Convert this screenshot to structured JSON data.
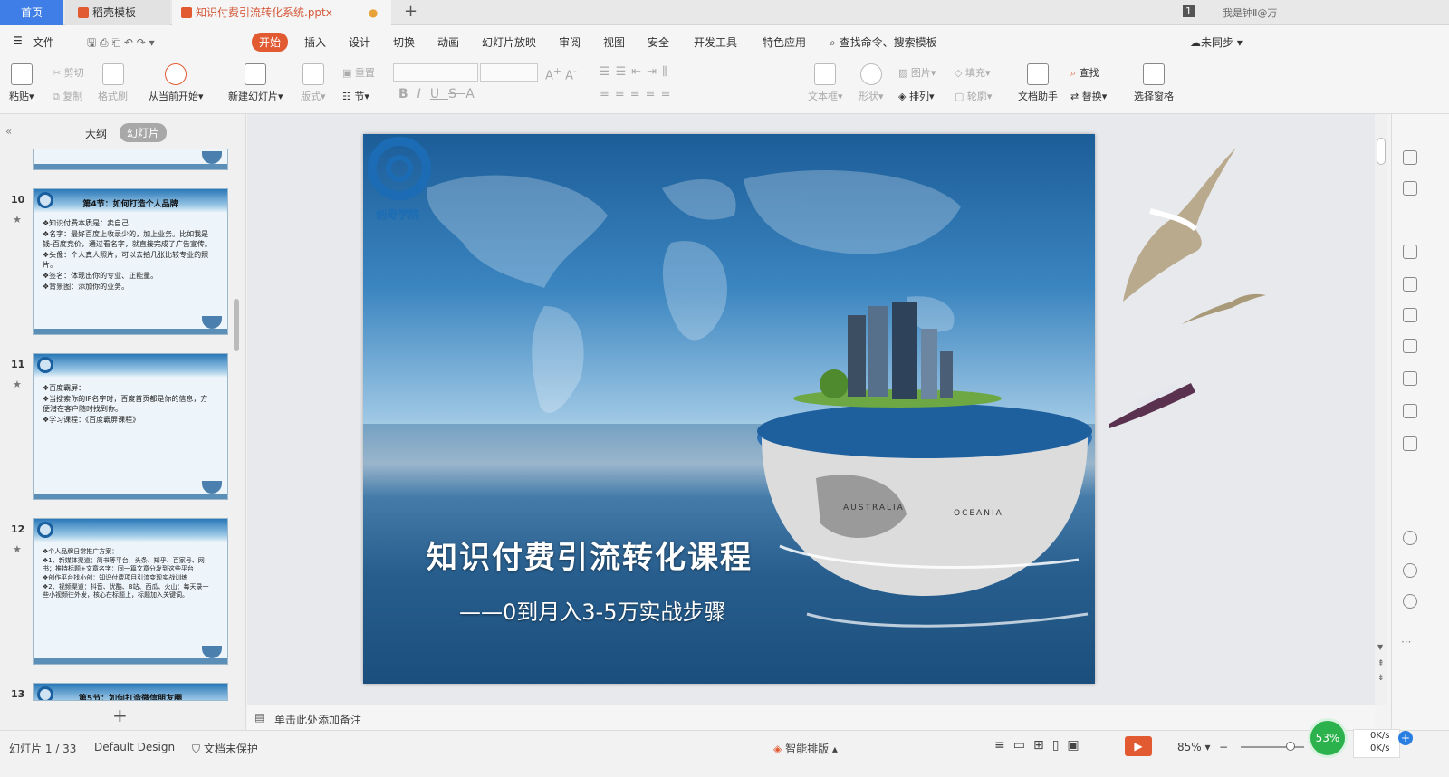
{
  "tabs": {
    "home": "首页",
    "template": "稻壳模板",
    "document": "知识付费引流转化系统.pptx",
    "badge": "1",
    "user": "我是钟Ⅱ@万"
  },
  "menu": {
    "file": "文件",
    "start": "开始",
    "insert": "插入",
    "design": "设计",
    "transition": "切换",
    "animation": "动画",
    "slideshow": "幻灯片放映",
    "review": "审阅",
    "view": "视图",
    "security": "安全",
    "devtools": "开发工具",
    "features": "特色应用",
    "search": "查找命令、搜索模板",
    "sync": "未同步"
  },
  "ribbon": {
    "paste": "粘贴",
    "cut": "剪切",
    "copy": "复制",
    "format_painter": "格式刷",
    "from_current": "从当前开始",
    "new_slide": "新建幻灯片",
    "layout": "版式",
    "reset": "重置",
    "section": "节",
    "textbox": "文本框",
    "shape": "形状",
    "picture": "图片",
    "fill": "填充",
    "arrange": "排列",
    "outline": "轮廓",
    "doc_assistant": "文档助手",
    "find": "查找",
    "replace": "替换",
    "select_pane": "选择窗格"
  },
  "sidebar": {
    "outline_tab": "大纲",
    "slides_tab": "幻灯片"
  },
  "slides": [
    {
      "num": "10",
      "title": "第4节：如何打造个人品牌",
      "lines": [
        "❖知识付费本质是：卖自己",
        "❖名字：最好百度上收录少的，加上业务。比如我是钱-百度竞价，通过看名字，就直接完成了广告宣传。",
        "❖头像：个人真人照片，可以去拍几张比较专业的照片。",
        "❖签名：体现出你的专业、正能量。",
        "❖背景图：添加你的业务。"
      ]
    },
    {
      "num": "11",
      "title": "",
      "lines": [
        "❖百度霸屏：",
        "❖当搜索你的IP名字时，百度首页都是你的信息，方便潜在客户随时找到你。",
        "❖学习课程：《百度霸屏课程》"
      ]
    },
    {
      "num": "12",
      "title": "",
      "lines": [
        "❖个人品牌日常推广方案：",
        "❖1、新媒体渠道：简书等平台，头条、知乎、百家号、网书；推特标题+文章名字：同一篇文章分发到这些平台",
        "❖创作平台找小创：知识付费项目引流变现实战训练",
        "❖2、视频渠道：抖音、优酷、B站、西瓜、火山：每天录一些小视频往外发，核心在标题上，标题加入关键词。"
      ]
    },
    {
      "num": "13",
      "title": "第5节：如何打造微信朋友圈",
      "lines": []
    }
  ],
  "main_slide": {
    "logo_text": "创奇学院",
    "title": "知识付费引流转化课程",
    "subtitle": "——0到月入3-5万实战步骤",
    "globe_label1": "AUSTRALIA",
    "globe_label2": "OCEANIA"
  },
  "notes_placeholder": "单击此处添加备注",
  "status": {
    "slide_info": "幻灯片 1 / 33",
    "theme": "Default Design",
    "protect": "文档未保护",
    "smart": "智能排版",
    "zoom": "85%",
    "perf": "53%",
    "net_up": "0K/s",
    "net_down": "0K/s"
  },
  "colors": {
    "accent": "#e25a32",
    "tab_active": "#3f7ee6",
    "slide_sky": "#3b85c0"
  }
}
